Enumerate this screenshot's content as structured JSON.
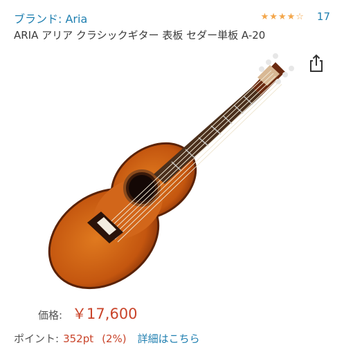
{
  "brand": {
    "label": "ブランド: Aria"
  },
  "rating": {
    "stars": 4.5,
    "count": "17"
  },
  "product": {
    "title": "ARIA アリア クラシックギター 表板 セダー単板 A-20"
  },
  "price": {
    "label": "価格:",
    "value": "￥17,600"
  },
  "points": {
    "label": "ポイント:",
    "value": "352pt",
    "percent": "(2%)",
    "link": "詳細はこちら"
  },
  "icons": {
    "share": "share-icon"
  }
}
